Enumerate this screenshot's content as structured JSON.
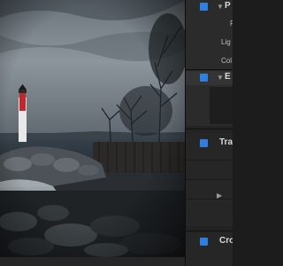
{
  "inspector": {
    "groups": [
      {
        "title": "P",
        "labels": [
          "F",
          "Lig",
          "Col"
        ]
      },
      {
        "title": "E"
      },
      {
        "title": "Tran"
      },
      {
        "title": "Cro"
      }
    ],
    "checkbox_color": "#2f7fe0"
  }
}
